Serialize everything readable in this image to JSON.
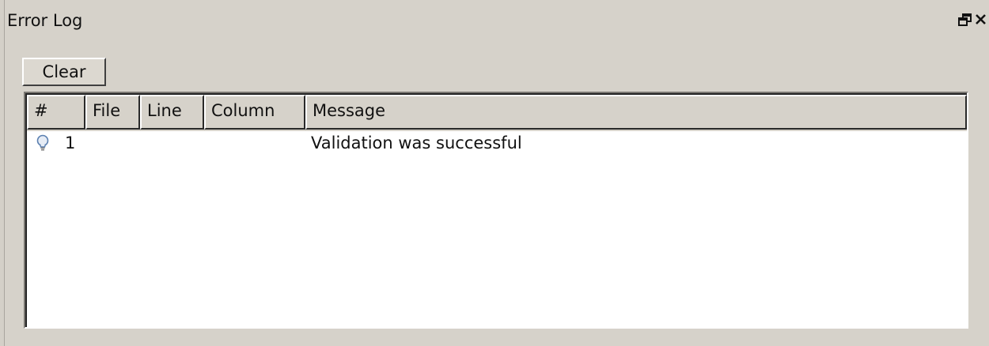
{
  "panel": {
    "title": "Error Log"
  },
  "toolbar": {
    "clear_label": "Clear"
  },
  "table": {
    "columns": [
      "#",
      "File",
      "Line",
      "Column",
      "Message"
    ],
    "rows": [
      {
        "icon": "lightbulb-icon",
        "index": "1",
        "file": "",
        "line": "",
        "column": "",
        "message": "Validation was successful"
      }
    ]
  },
  "icons": {
    "float": "float-window-icon",
    "close": "close-icon"
  }
}
